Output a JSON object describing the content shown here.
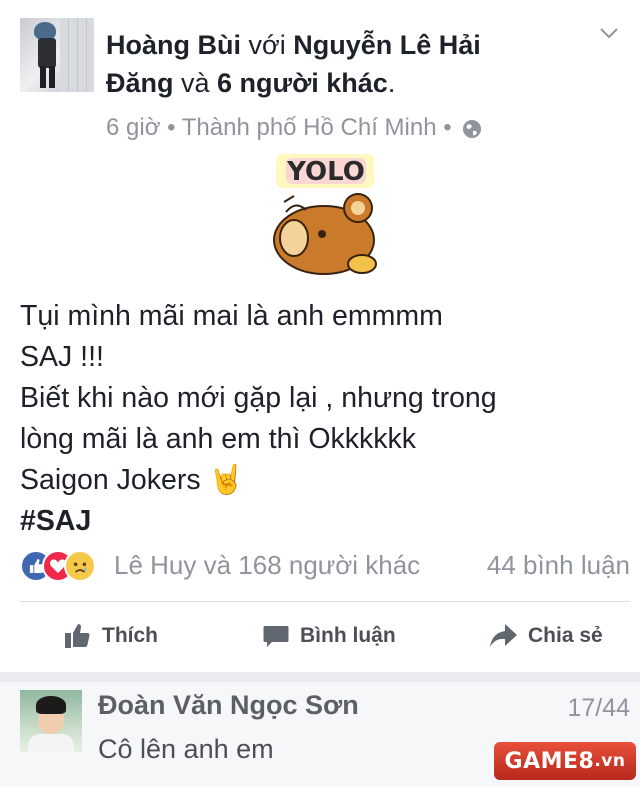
{
  "post": {
    "author": "Hoàng Bùi",
    "with_word": " với ",
    "tagged": "Nguyễn Lê Hải Đăng",
    "and_word": " và ",
    "others": "6 người khác",
    "period": ".",
    "time": "6 giờ",
    "location": "Thành phố Hồ Chí Minh",
    "privacy_icon": "globe-icon",
    "sticker_text": "YOLO",
    "lines": [
      "Tụi mình mãi mai là anh emmmm",
      "SAJ !!!",
      "Biết khi nào mới gặp lại , nhưng trong",
      "lòng mãi là anh em thì Okkkkkk",
      "Saigon Jokers 🤘"
    ],
    "hashtag": "#SAJ"
  },
  "reactions": {
    "icons": [
      "like-icon",
      "love-icon",
      "sad-icon"
    ],
    "summary": "Lê Huy và 168 người khác",
    "comments": "44 bình luận"
  },
  "actions": {
    "like": "Thích",
    "comment": "Bình luận",
    "share": "Chia sẻ"
  },
  "comment": {
    "author": "Đoàn Văn Ngọc Sơn",
    "text": "Cô lên anh em",
    "counter": "17/44"
  },
  "watermark": {
    "main": "GAME8",
    "suffix": ".vn"
  },
  "colors": {
    "text": "#1d2129",
    "muted": "#90949c",
    "like_blue": "#4267b2",
    "love_red": "#f0284a",
    "sad_yellow": "#f7c94b",
    "watermark_red": "#c8321f"
  }
}
